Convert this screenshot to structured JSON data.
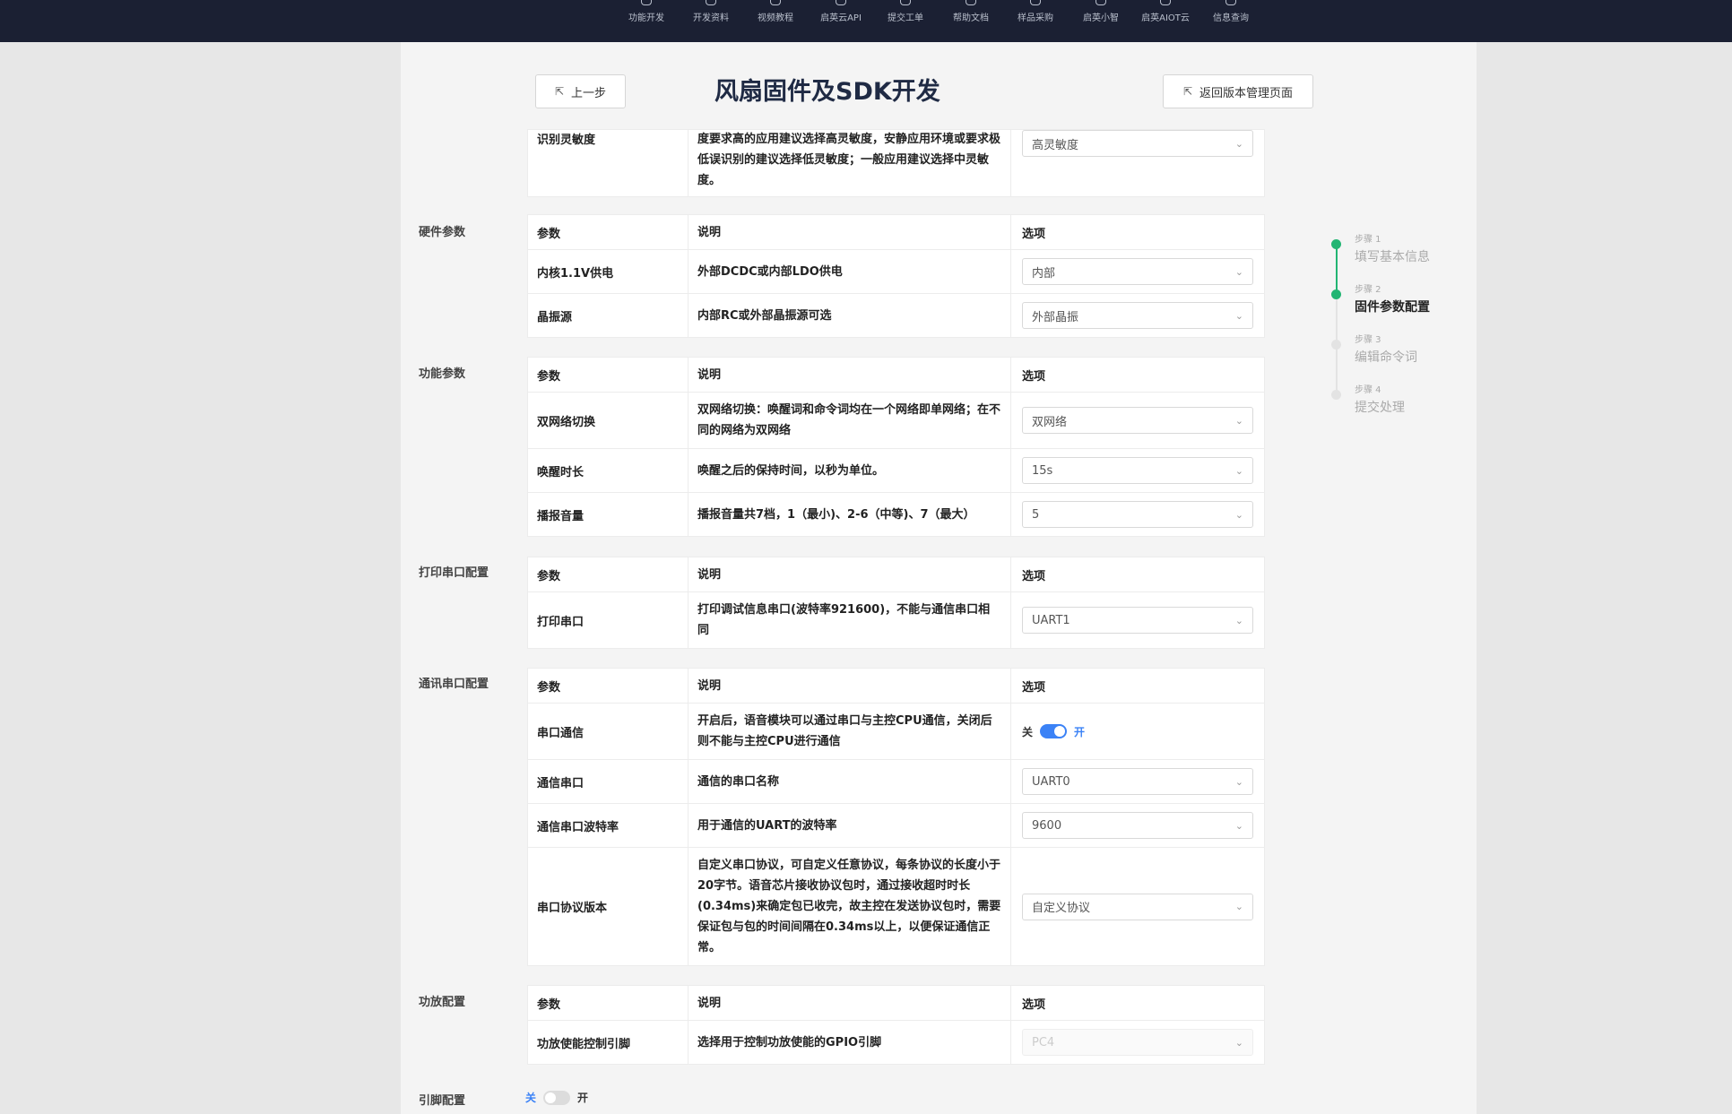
{
  "nav": [
    "功能开发",
    "开发资料",
    "视频教程",
    "启英云API",
    "提交工单",
    "帮助文档",
    "样品采购",
    "启英小智",
    "启英AIOT云",
    "信息查询"
  ],
  "header": {
    "back_label": "上一步",
    "title": "风扇固件及SDK开发",
    "return_label": "返回版本管理页面"
  },
  "table_headers": {
    "param": "参数",
    "desc": "说明",
    "option": "选项"
  },
  "partial": {
    "param": "识别灵敏度",
    "desc": "度要求高的应用建议选择高灵敏度，安静应用环境或要求极低误识别的建议选择低灵敏度；一般应用建议选择中灵敏度。",
    "value": "高灵敏度"
  },
  "sections": {
    "hardware": {
      "label": "硬件参数",
      "rows": [
        {
          "param": "内核1.1V供电",
          "desc": "外部DCDC或内部LDO供电",
          "value": "内部"
        },
        {
          "param": "晶振源",
          "desc": "内部RC或外部晶振源可选",
          "value": "外部晶振"
        }
      ]
    },
    "function": {
      "label": "功能参数",
      "rows": [
        {
          "param": "双网络切换",
          "desc": "双网络切换：唤醒词和命令词均在一个网络即单网络；在不同的网络为双网络",
          "value": "双网络"
        },
        {
          "param": "唤醒时长",
          "desc": "唤醒之后的保持时间，以秒为单位。",
          "value": "15s"
        },
        {
          "param": "播报音量",
          "desc": "播报音量共7档，1（最小)、2-6（中等)、7（最大）",
          "value": "5"
        }
      ]
    },
    "print": {
      "label": "打印串口配置",
      "rows": [
        {
          "param": "打印串口",
          "desc": "打印调试信息串口(波特率921600)，不能与通信串口相同",
          "value": "UART1"
        }
      ]
    },
    "comm": {
      "label": "通讯串口配置",
      "rows": [
        {
          "param": "串口通信",
          "desc": "开启后，语音模块可以通过串口与主控CPU通信，关闭后则不能与主控CPU进行通信",
          "off": "关",
          "on": "开"
        },
        {
          "param": "通信串口",
          "desc": "通信的串口名称",
          "value": "UART0"
        },
        {
          "param": "通信串口波特率",
          "desc": "用于通信的UART的波特率",
          "value": "9600"
        },
        {
          "param": "串口协议版本",
          "desc": "自定义串口协议，可自定义任意协议，每条协议的长度小于20字节。语音芯片接收协议包时，通过接收超时时长(0.34ms)来确定包已收完，故主控在发送协议包时，需要保证包与包的时间间隔在0.34ms以上，以便保证通信正常。",
          "value": "自定义协议"
        }
      ]
    },
    "amp": {
      "label": "功放配置",
      "rows": [
        {
          "param": "功放使能控制引脚",
          "desc": "选择用于控制功放使能的GPIO引脚",
          "value": "PC4"
        }
      ]
    },
    "pin": {
      "label": "引脚配置",
      "off": "关",
      "on": "开"
    }
  },
  "steps": [
    {
      "num": "步骤 1",
      "title": "填写基本信息"
    },
    {
      "num": "步骤 2",
      "title": "固件参数配置"
    },
    {
      "num": "步骤 3",
      "title": "编辑命令词"
    },
    {
      "num": "步骤 4",
      "title": "提交处理"
    }
  ],
  "colors": {
    "accent": "#3b82f6",
    "step_done": "#22b573",
    "nav_bg": "#1b2033"
  }
}
